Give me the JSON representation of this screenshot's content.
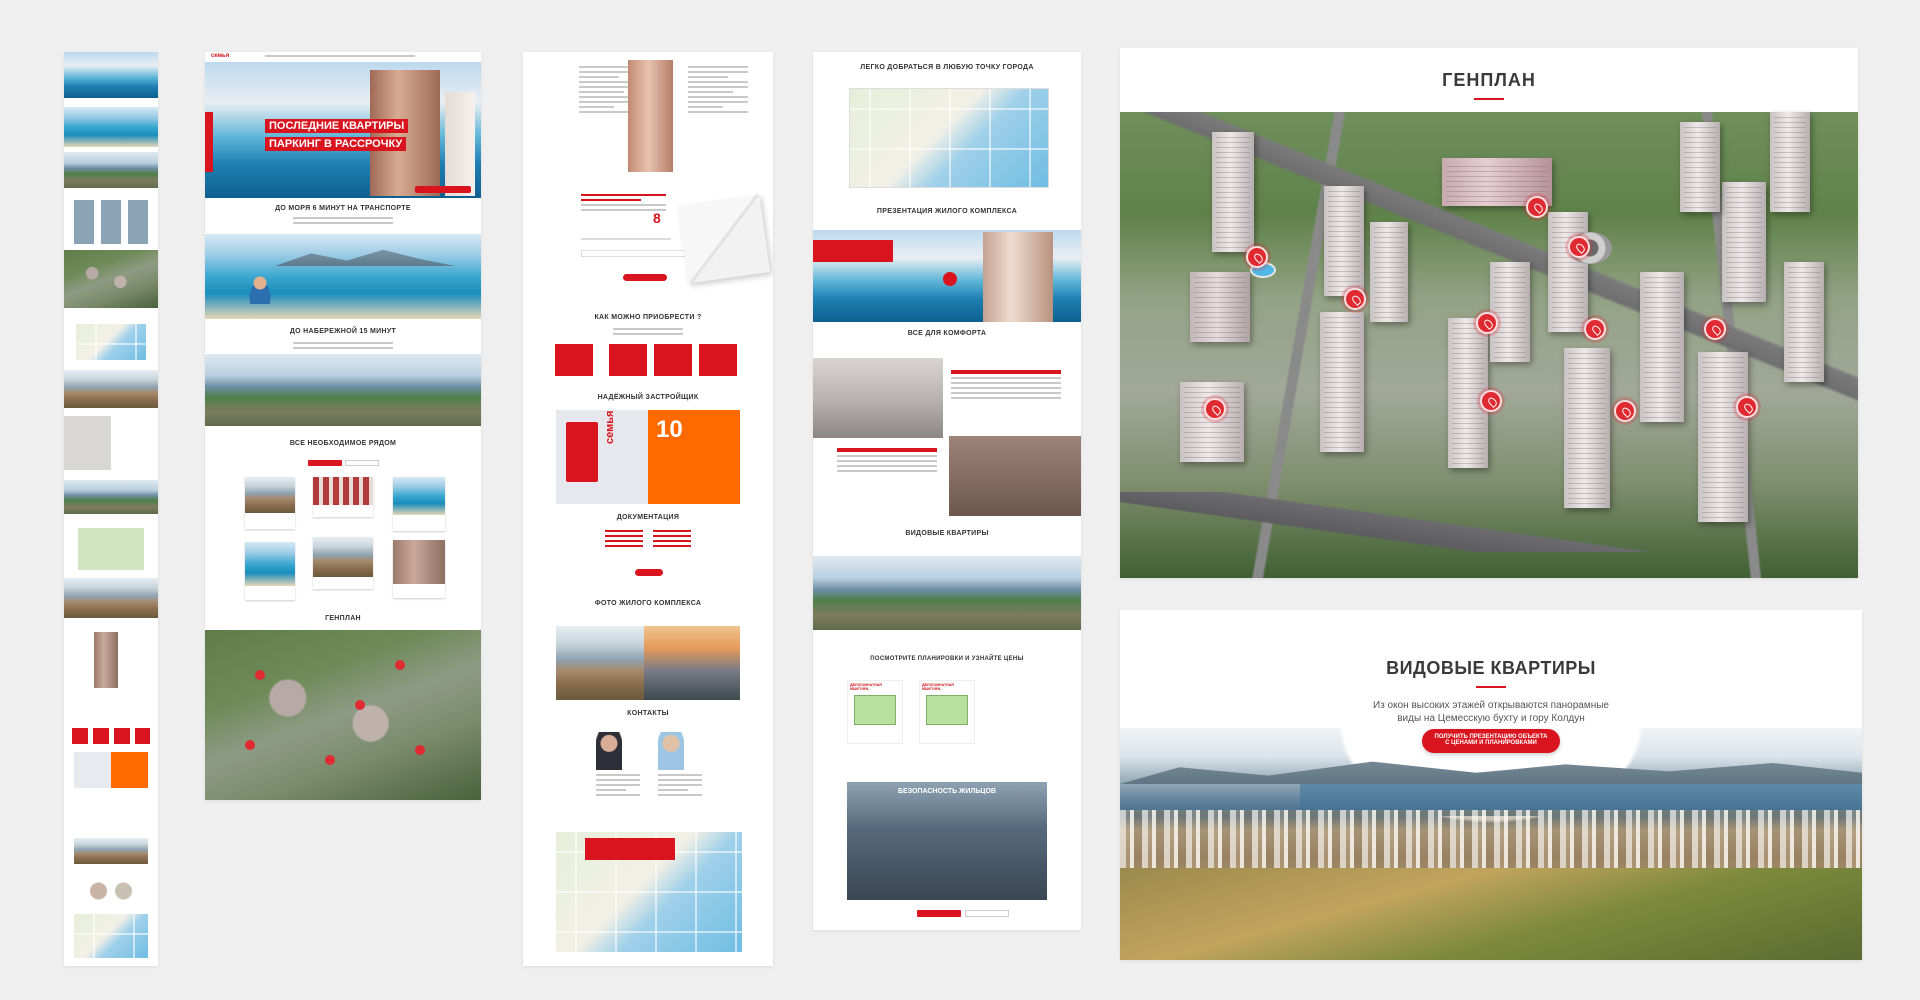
{
  "brand": {
    "logo": "семья",
    "accent": "#d9141e"
  },
  "page1": {
    "hero_title_1": "ПОСЛЕДНИЕ КВАРТИРЫ",
    "hero_title_2": "ПАРКИНГ В РАССРОЧКУ",
    "sea_title": "ДО МОРЯ 6 МИНУТ НА ТРАНСПОРТЕ",
    "embankment_title": "ДО НАБЕРЕЖНОЙ 15 МИНУТ",
    "nearby_title": "ВСЕ НЕОБХОДИМОЕ РЯДОМ",
    "genplan_title": "ГЕНПЛАН"
  },
  "page2": {
    "buy_title": "КАК МОЖНО ПРИОБРЕСТИ ?",
    "developer_title": "НАДЁЖНЫЙ ЗАСТРОЙЩИК",
    "developer_logo": "семья",
    "developer_years": "10",
    "docs_title": "ДОКУМЕНТАЦИЯ",
    "photos_title": "ФОТО ЖИЛОГО КОМПЛЕКСА",
    "contacts_title": "КОНТАКТЫ"
  },
  "page3": {
    "route_title": "ЛЕГКО ДОБРАТЬСЯ В ЛЮБУЮ ТОЧКУ ГОРОДА",
    "presentation_title": "ПРЕЗЕНТАЦИЯ ЖИЛОГО КОМПЛЕКСА",
    "comfort_title": "ВСЕ ДЛЯ КОМФОРТА",
    "view_title": "ВИДОВЫЕ КВАРТИРЫ",
    "plans_title": "ПОСМОТРИТЕ ПЛАНИРОВКИ И УЗНАЙТЕ ЦЕНЫ",
    "plan_label": "ДВУХКОМНАТНАЯ КВАРТИРА",
    "security_title": "БЕЗОПАСНОСТЬ ЖИЛЬЦОВ"
  },
  "genplan": {
    "title": "ГЕНПЛАН"
  },
  "view_apartments": {
    "title": "ВИДОВЫЕ КВАРТИРЫ",
    "text_line1": "Из окон высоких этажей открываются панорамные",
    "text_line2": "виды на Цемесскую бухту и гору Колдун",
    "button_line1": "ПОЛУЧИТЬ ПРЕЗЕНТАЦИЮ ОБЪЕКТА",
    "button_line2": "С ЦЕНАМИ И ПЛАНИРОВКАМИ"
  }
}
